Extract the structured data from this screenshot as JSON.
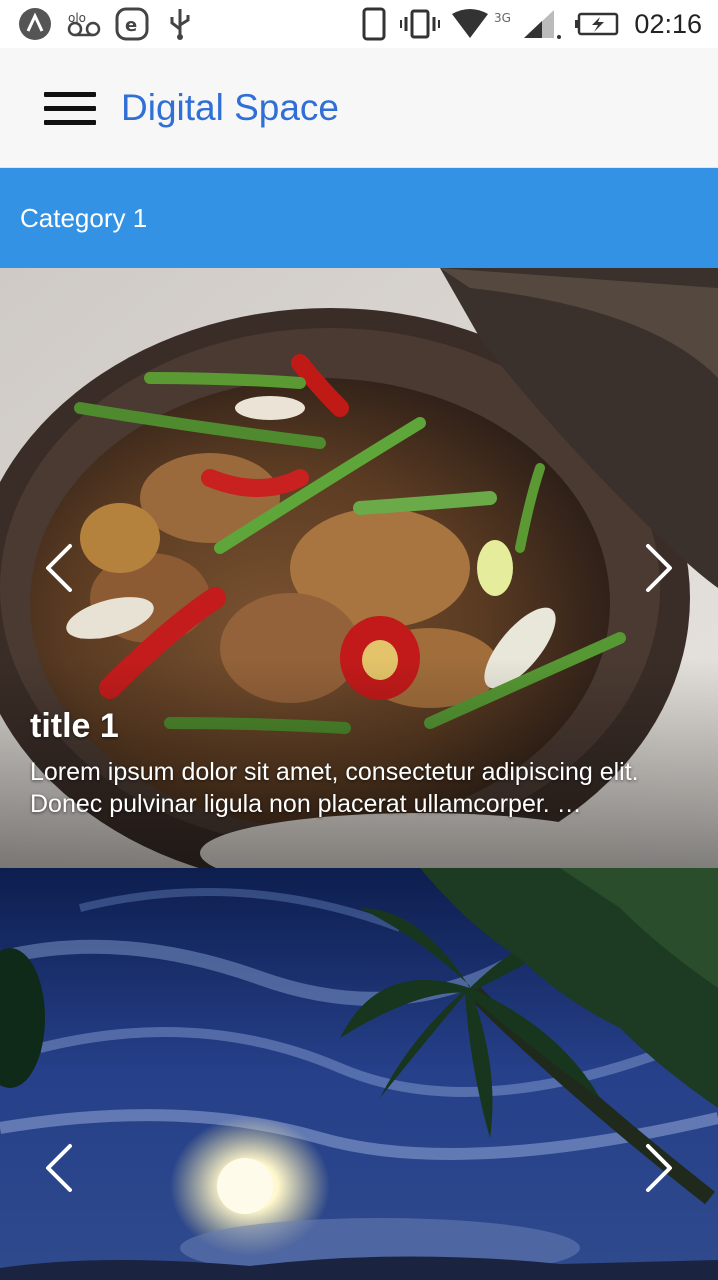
{
  "status_bar": {
    "time": "02:16",
    "left_icons": [
      "app-a-icon",
      "voicemail-icon",
      "e-app-icon",
      "usb-icon"
    ],
    "right_icons": [
      "phone-outline-icon",
      "vibrate-icon",
      "wifi-icon",
      "signal-icon",
      "battery-charging-icon"
    ],
    "network_type": "3G"
  },
  "app_bar": {
    "menu_icon": "hamburger-menu-icon",
    "title": "Digital Space"
  },
  "category": {
    "label": "Category 1",
    "color": "#3392e3"
  },
  "carousel": [
    {
      "image": "food-stew-in-clay-pot",
      "title": "title 1",
      "description": "Lorem ipsum dolor sit amet, consectetur adipiscing elit. Donec pulvinar ligula non placerat ullamcorper. …",
      "prev_icon": "chevron-left-icon",
      "next_icon": "chevron-right-icon"
    },
    {
      "image": "sunset-palm-tree-sky",
      "prev_icon": "chevron-left-icon",
      "next_icon": "chevron-right-icon"
    }
  ],
  "colors": {
    "title_blue": "#2f6fd6",
    "category_blue": "#3392e3"
  }
}
